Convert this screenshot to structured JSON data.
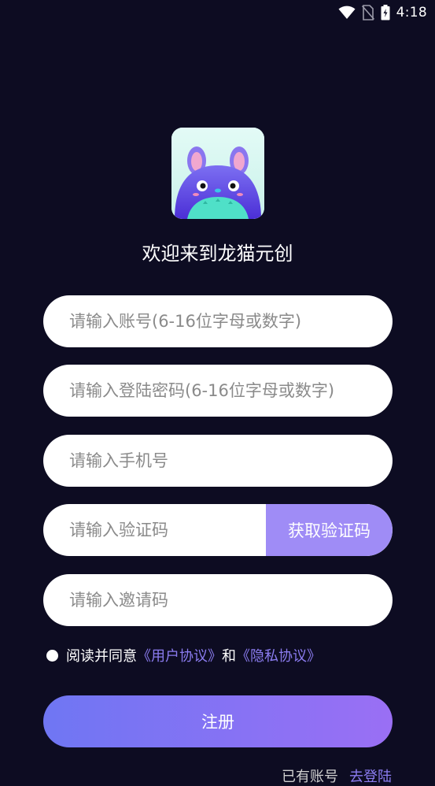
{
  "status_bar": {
    "time": "4:18",
    "icons": [
      "wifi-icon",
      "no-sim-icon",
      "battery-charging-icon"
    ]
  },
  "app": {
    "welcome": "欢迎来到龙猫元创"
  },
  "form": {
    "account_placeholder": "请输入账号(6-16位字母或数字)",
    "password_placeholder": "请输入登陆密码(6-16位字母或数字)",
    "phone_placeholder": "请输入手机号",
    "code_placeholder": "请输入验证码",
    "get_code_label": "获取验证码",
    "invite_placeholder": "请输入邀请码"
  },
  "agreement": {
    "prefix": "阅读并同意",
    "user_agreement": "《用户协议》",
    "and": "和",
    "privacy_agreement": "《隐私协议》"
  },
  "register_label": "注册",
  "login_prompt": {
    "text": "已有账号",
    "link": "去登陆"
  },
  "colors": {
    "background": "#0d0c22",
    "accent": "#8b7cf0",
    "button_gradient_start": "#6f76f3",
    "button_gradient_end": "#9a6ff4"
  }
}
